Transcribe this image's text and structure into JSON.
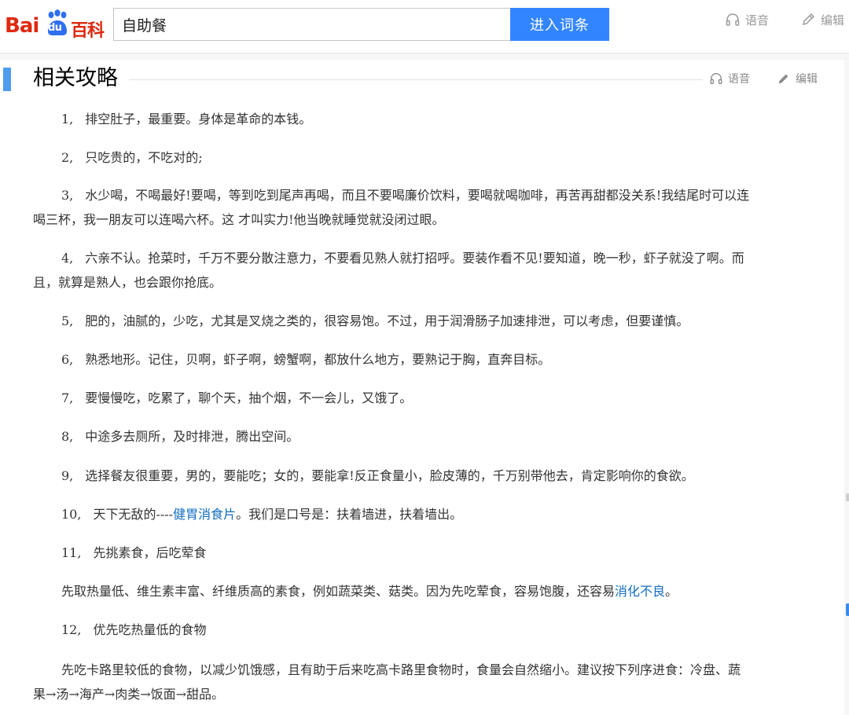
{
  "header": {
    "logo_left": "Bai",
    "logo_mid": "du",
    "logo_right": "百科",
    "search_value": "自助餐",
    "search_button": "进入词条",
    "voice_label": "语音",
    "edit_label": "编辑"
  },
  "section": {
    "title": "相关攻略",
    "voice_label": "语音",
    "edit_label": "编辑"
  },
  "paragraphs": {
    "p1": {
      "num": "1,",
      "text": "排空肚子，最重要。身体是革命的本钱。"
    },
    "p2": {
      "num": "2,",
      "text": "只吃贵的，不吃对的;"
    },
    "p3": {
      "num": "3,",
      "line1": "水少喝，不喝最好!要喝，等到吃到尾声再喝，而且不要喝廉价饮料，要喝就喝咖啡，再苦再甜都没关系!我结尾时可以连",
      "line2": "喝三杯，我一朋友可以连喝六杯。这 才叫实力!他当晚就睡觉就没闭过眼。"
    },
    "p4": {
      "num": "4,",
      "line1": "六亲不认。抢菜时，千万不要分散注意力，不要看见熟人就打招呼。要装作看不见!要知道，晚一秒，虾子就没了啊。而",
      "line2": "且，就算是熟人，也会跟你抢底。"
    },
    "p5": {
      "num": "5,",
      "text": "肥的，油腻的，少吃，尤其是叉烧之类的，很容易饱。不过，用于润滑肠子加速排泄，可以考虑，但要谨慎。"
    },
    "p6": {
      "num": "6,",
      "text": "熟悉地形。记住，贝啊，虾子啊，螃蟹啊，都放什么地方，要熟记于胸，直奔目标。"
    },
    "p7": {
      "num": "7,",
      "text": "要慢慢吃，吃累了，聊个天，抽个烟，不一会儿，又饿了。"
    },
    "p8": {
      "num": "8,",
      "text": "中途多去厕所，及时排泄，腾出空间。"
    },
    "p9": {
      "num": "9,",
      "text": "选择餐友很重要，男的，要能吃；女的，要能拿!反正食量小，脸皮薄的，千万别带他去，肯定影响你的食欲。"
    },
    "p10": {
      "num": "10,",
      "before": "天下无敌的----",
      "link": "健胃消食片",
      "after": "。我们是口号是：扶着墙进，扶着墙出。"
    },
    "p11": {
      "num": "11,",
      "text": "先挑素食，后吃荤食"
    },
    "p11b": {
      "before": "先取热量低、维生素丰富、纤维质高的素食，例如蔬菜类、菇类。因为先吃荤食，容易饱腹，还容易",
      "link": "消化不良",
      "after": "。"
    },
    "p12": {
      "num": "12,",
      "text": "优先吃热量低的食物"
    },
    "p12b": {
      "line1": "先吃卡路里较低的食物，以减少饥饿感，且有助于后来吃高卡路里食物时，食量会自然缩小。建议按下列序进食：冷盘、蔬",
      "line2": "果→汤→海产→肉类→饭面→甜品。"
    }
  },
  "colors": {
    "accent": "#3385ff",
    "logo_red": "#de2910",
    "link": "#136ec2",
    "section_bar": "#4f9cee"
  }
}
